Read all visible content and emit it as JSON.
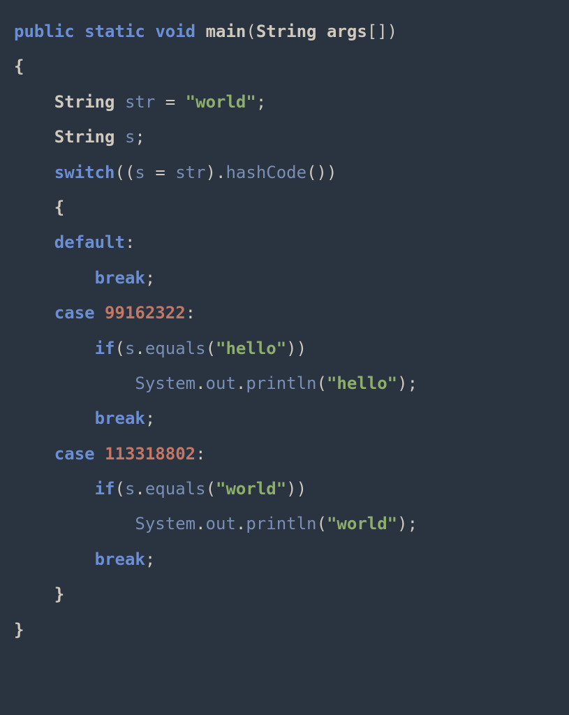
{
  "code": {
    "kw_public": "public",
    "kw_static": "static",
    "kw_void": "void",
    "fn_main": "main",
    "type_string": "String",
    "id_args": "args",
    "brackets": "[]",
    "paren_open": "(",
    "paren_close": ")",
    "brace_open": "{",
    "brace_close": "}",
    "id_str": "str",
    "eq": "=",
    "val_world": "\"world\"",
    "semi": ";",
    "id_s": "s",
    "kw_switch": "switch",
    "dot": ".",
    "fn_hashcode": "hashCode",
    "kw_default": "default",
    "colon": ":",
    "kw_break": "break",
    "kw_case": "case",
    "num_hello": "99162322",
    "num_world": "113318802",
    "kw_if": "if",
    "fn_equals": "equals",
    "val_hello": "\"hello\"",
    "sys": "System",
    "out": "out",
    "println": "println"
  }
}
